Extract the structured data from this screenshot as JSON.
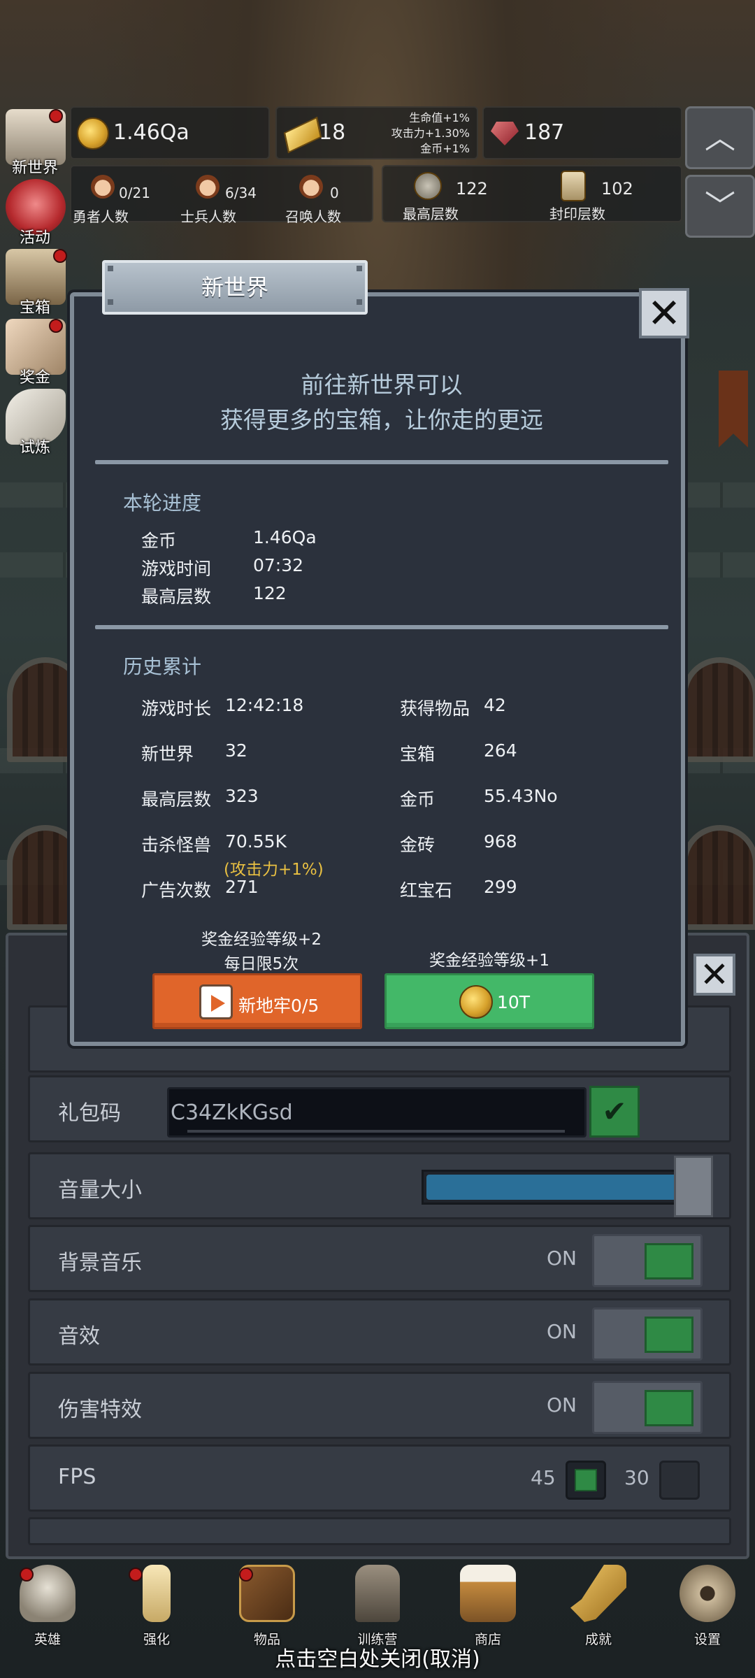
{
  "hud": {
    "gold": "1.46Qa",
    "gold_bars": "18",
    "bonus_lines": [
      "生命值+1%",
      "攻击力+1.30%",
      "金币+1%"
    ],
    "rubies": "187",
    "heroes": {
      "count": "0/21",
      "label": "勇者人数"
    },
    "soldiers": {
      "count": "6/34",
      "label": "士兵人数"
    },
    "summons": {
      "count": "0",
      "label": "召唤人数"
    },
    "max_floor": {
      "count": "122",
      "label": "最高层数"
    },
    "sealed_floor": {
      "count": "102",
      "label": "封印层数"
    },
    "arrow_up": "︿",
    "arrow_down": "﹀"
  },
  "side_menu": [
    {
      "label": "新世界",
      "dot": true
    },
    {
      "label": "活动",
      "dot": false
    },
    {
      "label": "宝箱",
      "dot": true
    },
    {
      "label": "奖金",
      "dot": true
    },
    {
      "label": "试炼",
      "dot": false
    }
  ],
  "modal": {
    "title": "新世界",
    "close_symbol": "✕",
    "intro_line1": "前往新世界可以",
    "intro_line2": "获得更多的宝箱，让你走的更远",
    "current": {
      "heading": "本轮进度",
      "rows": [
        {
          "k": "金币",
          "v": "1.46Qa"
        },
        {
          "k": "游戏时间",
          "v": "07:32"
        },
        {
          "k": "最高层数",
          "v": "122"
        }
      ]
    },
    "history": {
      "heading": "历史累计",
      "left": [
        {
          "k": "游戏时长",
          "v": "12:42:18"
        },
        {
          "k": "新世界",
          "v": "32"
        },
        {
          "k": "最高层数",
          "v": "323"
        },
        {
          "k": "击杀怪兽",
          "v": "70.55K"
        },
        {
          "k": "广告次数",
          "v": "271"
        }
      ],
      "kill_bonus": "(攻击力+1%)",
      "right": [
        {
          "k": "获得物品",
          "v": "42"
        },
        {
          "k": "宝箱",
          "v": "264"
        },
        {
          "k": "金币",
          "v": "55.43No"
        },
        {
          "k": "金砖",
          "v": "968"
        },
        {
          "k": "红宝石",
          "v": "299"
        }
      ]
    },
    "ad_caption1": "奖金经验等级+2",
    "ad_caption2": "每日限5次",
    "ad_button": "新地牢0/5",
    "coin_caption": "奖金经验等级+1",
    "coin_button": "10T"
  },
  "settings": {
    "close_symbol": "✕",
    "gift_label": "礼包码",
    "gift_value": "C34ZkKGsd",
    "confirm_symbol": "✔",
    "volume_label": "音量大小",
    "volume_level": 0.92,
    "bgm_label": "背景音乐",
    "bgm_state": "ON",
    "sfx_label": "音效",
    "sfx_state": "ON",
    "dmg_label": "伤害特效",
    "dmg_state": "ON",
    "fps_label": "FPS",
    "fps_a": "45",
    "fps_b": "30"
  },
  "bottom_nav": [
    {
      "label": "英雄",
      "dot": true
    },
    {
      "label": "强化",
      "dot": true
    },
    {
      "label": "物品",
      "dot": true
    },
    {
      "label": "训练营",
      "dot": false
    },
    {
      "label": "商店",
      "dot": false
    },
    {
      "label": "成就",
      "dot": false
    },
    {
      "label": "设置",
      "dot": false
    }
  ],
  "bottom_hint": "点击空白处关闭(取消)",
  "colors": {
    "accent_orange": "#e0652a",
    "accent_green": "#43b868",
    "gold_text": "#e9c042",
    "modal_bg": "#2b313c"
  }
}
